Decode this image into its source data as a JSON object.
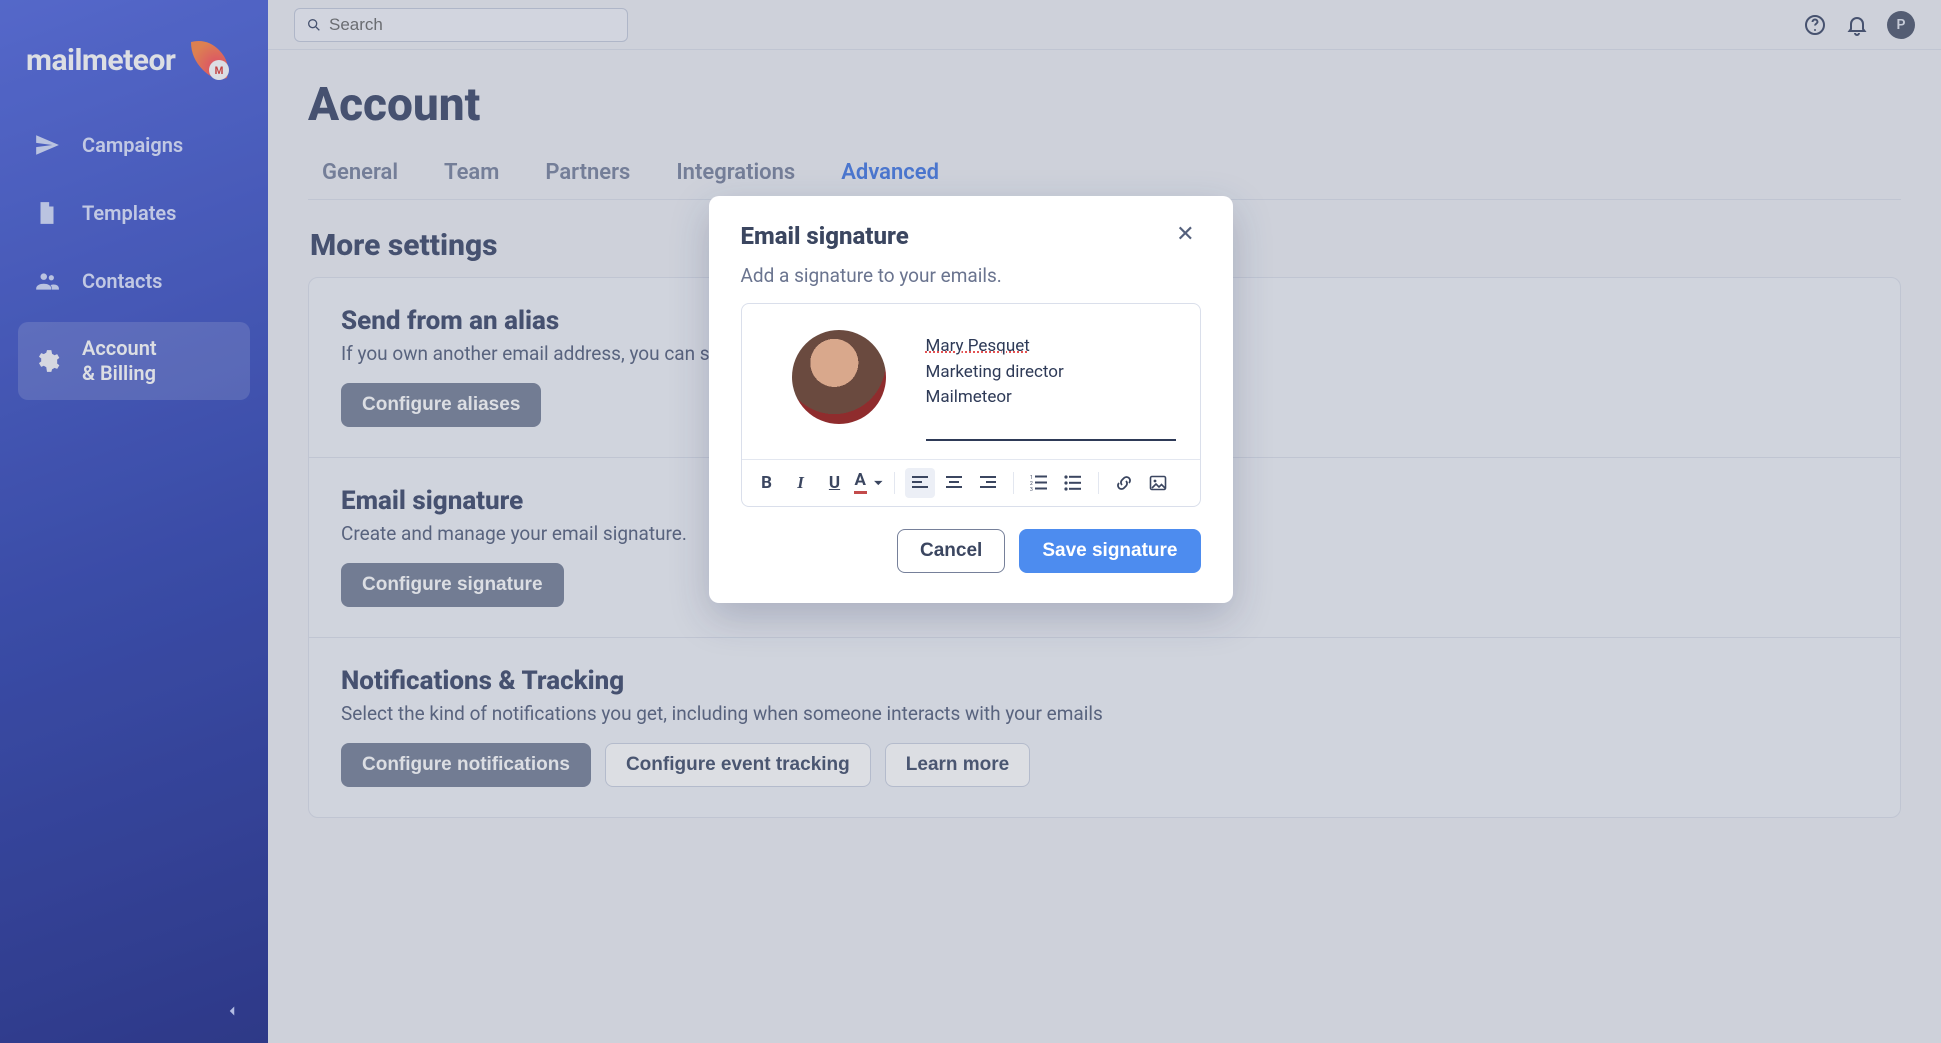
{
  "brand": {
    "name": "mailmeteor"
  },
  "sidebar": {
    "items": [
      {
        "label": "Campaigns"
      },
      {
        "label": "Templates"
      },
      {
        "label": "Contacts"
      },
      {
        "label": "Account\n& Billing"
      }
    ],
    "active_index": 3
  },
  "topbar": {
    "search_placeholder": "Search",
    "avatar_initial": "P"
  },
  "page": {
    "title": "Account",
    "tabs": [
      {
        "label": "General"
      },
      {
        "label": "Team"
      },
      {
        "label": "Partners"
      },
      {
        "label": "Integrations"
      },
      {
        "label": "Advanced"
      }
    ],
    "active_tab_index": 4,
    "section_heading": "More settings",
    "cards": [
      {
        "title": "Send from an alias",
        "subtitle": "If you own another email address, you can send emails from that address.",
        "buttons": [
          {
            "label": "Configure aliases",
            "style": "primary"
          }
        ]
      },
      {
        "title": "Email signature",
        "subtitle": "Create and manage your email signature.",
        "buttons": [
          {
            "label": "Configure signature",
            "style": "primary"
          }
        ]
      },
      {
        "title": "Notifications & Tracking",
        "subtitle": "Select the kind of notifications you get, including when someone interacts with your emails",
        "buttons": [
          {
            "label": "Configure notifications",
            "style": "primary"
          },
          {
            "label": "Configure event tracking",
            "style": "secondary"
          },
          {
            "label": "Learn more",
            "style": "secondary"
          }
        ]
      }
    ]
  },
  "modal": {
    "title": "Email signature",
    "subtitle": "Add a signature to your emails.",
    "signature": {
      "name": "Mary Pesquet",
      "role": "Marketing director",
      "company": "Mailmeteor"
    },
    "actions": {
      "cancel": "Cancel",
      "save": "Save signature"
    },
    "toolbar_icons": [
      "bold-icon",
      "italic-icon",
      "underline-icon",
      "text-color-icon",
      "align-left-icon",
      "align-center-icon",
      "align-right-icon",
      "ordered-list-icon",
      "bullet-list-icon",
      "link-icon",
      "image-icon"
    ]
  },
  "colors": {
    "accent": "#4d8cef",
    "sidebar_gradient_from": "#5a6fe0",
    "sidebar_gradient_to": "#2b3690"
  }
}
